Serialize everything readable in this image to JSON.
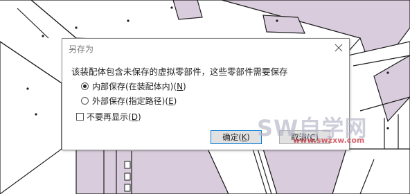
{
  "dialog": {
    "title": "另存为",
    "message": "该装配体包含未保存的虚拟零部件，这些零部件需要保存",
    "options": [
      {
        "label": "内部保存(在装配体内)",
        "mnemonic": "N",
        "selected": true
      },
      {
        "label": "外部保存(指定路径)",
        "mnemonic": "E",
        "selected": false
      }
    ],
    "checkbox": {
      "label": "不要再显示",
      "mnemonic": "D",
      "checked": false
    },
    "ok": {
      "label": "确定",
      "mnemonic": "K"
    },
    "cancel": {
      "label": "取消",
      "mnemonic": "C"
    }
  },
  "watermark": {
    "text": "SW自学网",
    "url": "www.swzxw.com"
  },
  "colors": {
    "drawing_fill": "#d9ccdc",
    "drawing_line": "#1e1e1e",
    "ok_border": "#0078d7"
  }
}
